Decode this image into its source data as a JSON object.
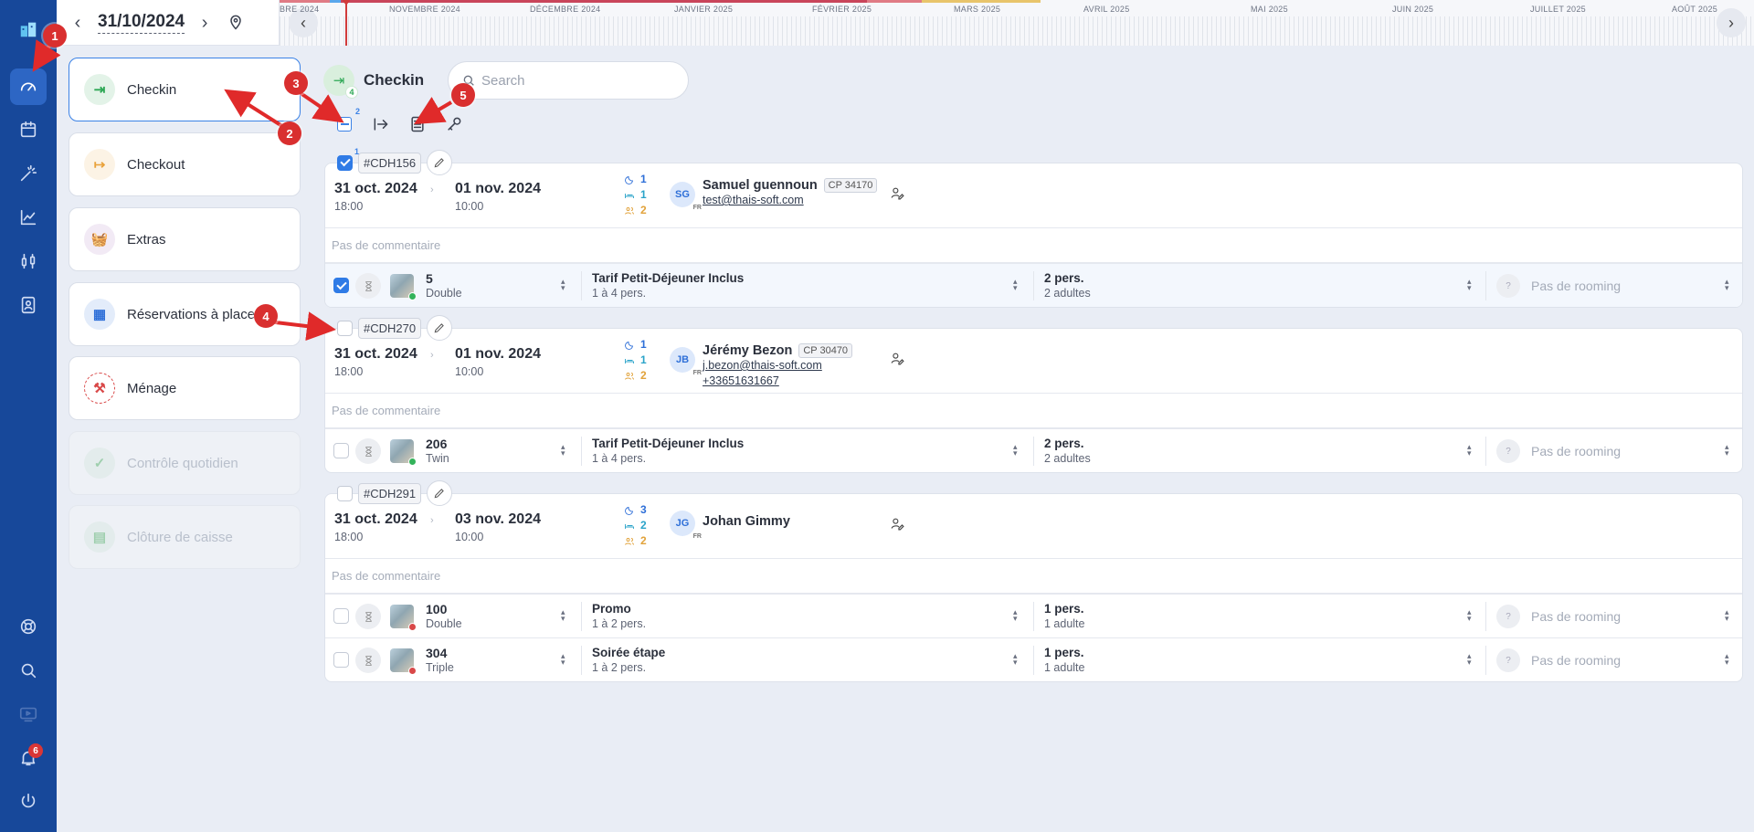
{
  "topbar": {
    "date": "31/10/2024",
    "timeline_months": [
      "BRE 2024",
      "NOVEMBRE 2024",
      "DÉCEMBRE 2024",
      "JANVIER 2025",
      "FÉVRIER 2025",
      "MARS 2025",
      "AVRIL 2025",
      "MAI 2025",
      "JUIN 2025",
      "JUILLET 2025",
      "AOÛT 2025"
    ]
  },
  "sidebar": {
    "icons": [
      "hotel-logo-icon",
      "dashboard-icon",
      "calendar-icon",
      "magic-wand-icon",
      "chart-icon",
      "sliders-icon",
      "contact-card-icon",
      "help-icon",
      "search-icon",
      "monitor-icon",
      "bell-icon",
      "power-icon"
    ],
    "notification_count": "6"
  },
  "left_menu": {
    "items": [
      {
        "label": "Checkin",
        "color": "#2fa856"
      },
      {
        "label": "Checkout",
        "color": "#e9a23b"
      },
      {
        "label": "Extras",
        "color": "#9b5fb5"
      },
      {
        "label": "Réservations à placer",
        "color": "#2e6fd8"
      },
      {
        "label": "Ménage",
        "color": "#d94848"
      },
      {
        "label": "Contrôle quotidien",
        "color": "#9fcfae"
      },
      {
        "label": "Clôture de caisse",
        "color": "#9fcfae"
      }
    ]
  },
  "main": {
    "title": "Checkin",
    "title_badge": "4",
    "search_placeholder": "Search",
    "selection_count": "2",
    "first_booking_count": "1"
  },
  "bookings": [
    {
      "ref": "#CDH156",
      "checked": true,
      "arrival_date": "31 oct. 2024",
      "arrival_time": "18:00",
      "departure_date": "01 nov. 2024",
      "departure_time": "10:00",
      "nights": "1",
      "rooms": "1",
      "persons": "2",
      "initials": "SG",
      "flag": "FR",
      "guest": "Samuel guennoun",
      "postcode": "CP 34170",
      "email": "test@thais-soft.com",
      "phone": "",
      "comment": "Pas de commentaire",
      "rows": [
        {
          "checked": true,
          "number": "5",
          "type": "Double",
          "dot": "#33b35a",
          "rate": "Tarif Petit-Déjeuner Inclus",
          "rate_cap": "1 à 4 pers.",
          "pax": "2 pers.",
          "pax_detail": "2 adultes",
          "rooming": "Pas de rooming"
        }
      ]
    },
    {
      "ref": "#CDH270",
      "checked": false,
      "arrival_date": "31 oct. 2024",
      "arrival_time": "18:00",
      "departure_date": "01 nov. 2024",
      "departure_time": "10:00",
      "nights": "1",
      "rooms": "1",
      "persons": "2",
      "initials": "JB",
      "flag": "FR",
      "guest": "Jérémy Bezon",
      "postcode": "CP 30470",
      "email": "j.bezon@thais-soft.com",
      "phone": "+33651631667",
      "comment": "Pas de commentaire",
      "rows": [
        {
          "checked": false,
          "number": "206",
          "type": "Twin",
          "dot": "#33b35a",
          "rate": "Tarif Petit-Déjeuner Inclus",
          "rate_cap": "1 à 4 pers.",
          "pax": "2 pers.",
          "pax_detail": "2 adultes",
          "rooming": "Pas de rooming"
        }
      ]
    },
    {
      "ref": "#CDH291",
      "checked": false,
      "arrival_date": "31 oct. 2024",
      "arrival_time": "18:00",
      "departure_date": "03 nov. 2024",
      "departure_time": "10:00",
      "nights": "3",
      "rooms": "2",
      "persons": "2",
      "initials": "JG",
      "flag": "FR",
      "guest": "Johan Gimmy",
      "postcode": "",
      "email": "",
      "phone": "",
      "comment": "Pas de commentaire",
      "rows": [
        {
          "checked": false,
          "number": "100",
          "type": "Double",
          "dot": "#d94848",
          "rate": "Promo",
          "rate_cap": "1 à 2 pers.",
          "pax": "1 pers.",
          "pax_detail": "1 adulte",
          "rooming": "Pas de rooming"
        },
        {
          "checked": false,
          "number": "304",
          "type": "Triple",
          "dot": "#d94848",
          "rate": "Soirée étape",
          "rate_cap": "1 à 2 pers.",
          "pax": "1 pers.",
          "pax_detail": "1 adulte",
          "rooming": "Pas de rooming"
        }
      ]
    }
  ],
  "annotations": [
    "1",
    "2",
    "3",
    "4",
    "5"
  ]
}
